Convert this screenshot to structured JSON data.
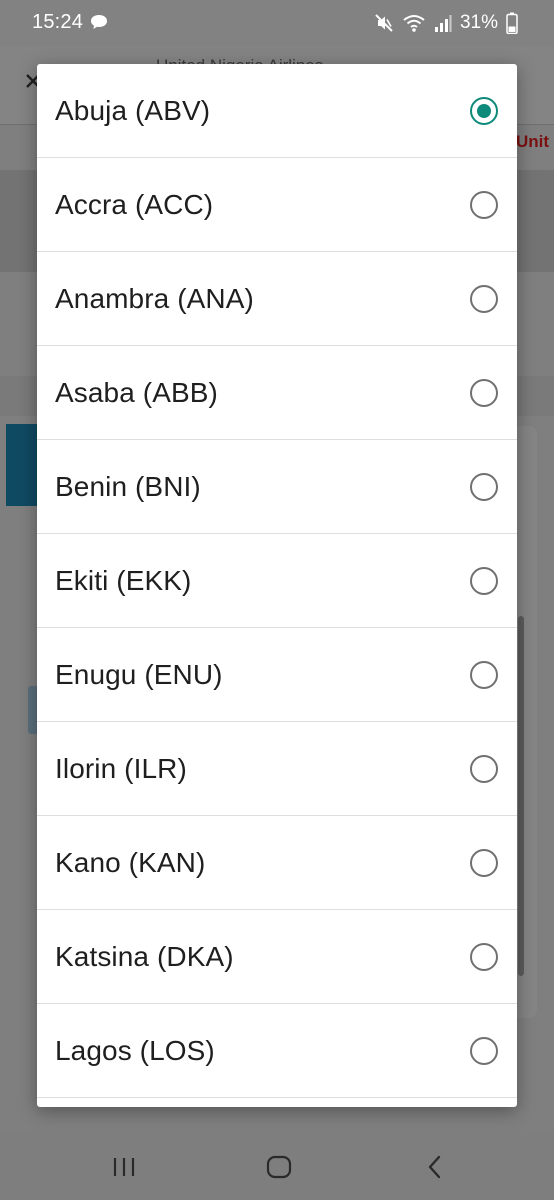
{
  "status_bar": {
    "time": "15:24",
    "battery": "31%"
  },
  "background": {
    "header_title": "United Nigeria Airlines",
    "side_text": "Unit"
  },
  "dialog": {
    "selected_index": 0,
    "options": [
      {
        "label": "Abuja (ABV)",
        "checked": true
      },
      {
        "label": "Accra (ACC)",
        "checked": false
      },
      {
        "label": "Anambra (ANA)",
        "checked": false
      },
      {
        "label": "Asaba (ABB)",
        "checked": false
      },
      {
        "label": "Benin (BNI)",
        "checked": false
      },
      {
        "label": "Ekiti (EKK)",
        "checked": false
      },
      {
        "label": "Enugu (ENU)",
        "checked": false
      },
      {
        "label": "Ilorin (ILR)",
        "checked": false
      },
      {
        "label": "Kano (KAN)",
        "checked": false
      },
      {
        "label": "Katsina (DKA)",
        "checked": false
      },
      {
        "label": "Lagos (LOS)",
        "checked": false
      }
    ]
  },
  "colors": {
    "accent": "#0e8a7a",
    "radio_unchecked": "#707070",
    "scrim": "#7b7b7b"
  },
  "icons": {
    "status_left": "chat-bubble-icon",
    "status_right": [
      "mute-icon",
      "wifi-icon",
      "signal-icon",
      "battery-icon"
    ],
    "nav": [
      "recent-apps-icon",
      "home-icon",
      "back-icon"
    ]
  }
}
